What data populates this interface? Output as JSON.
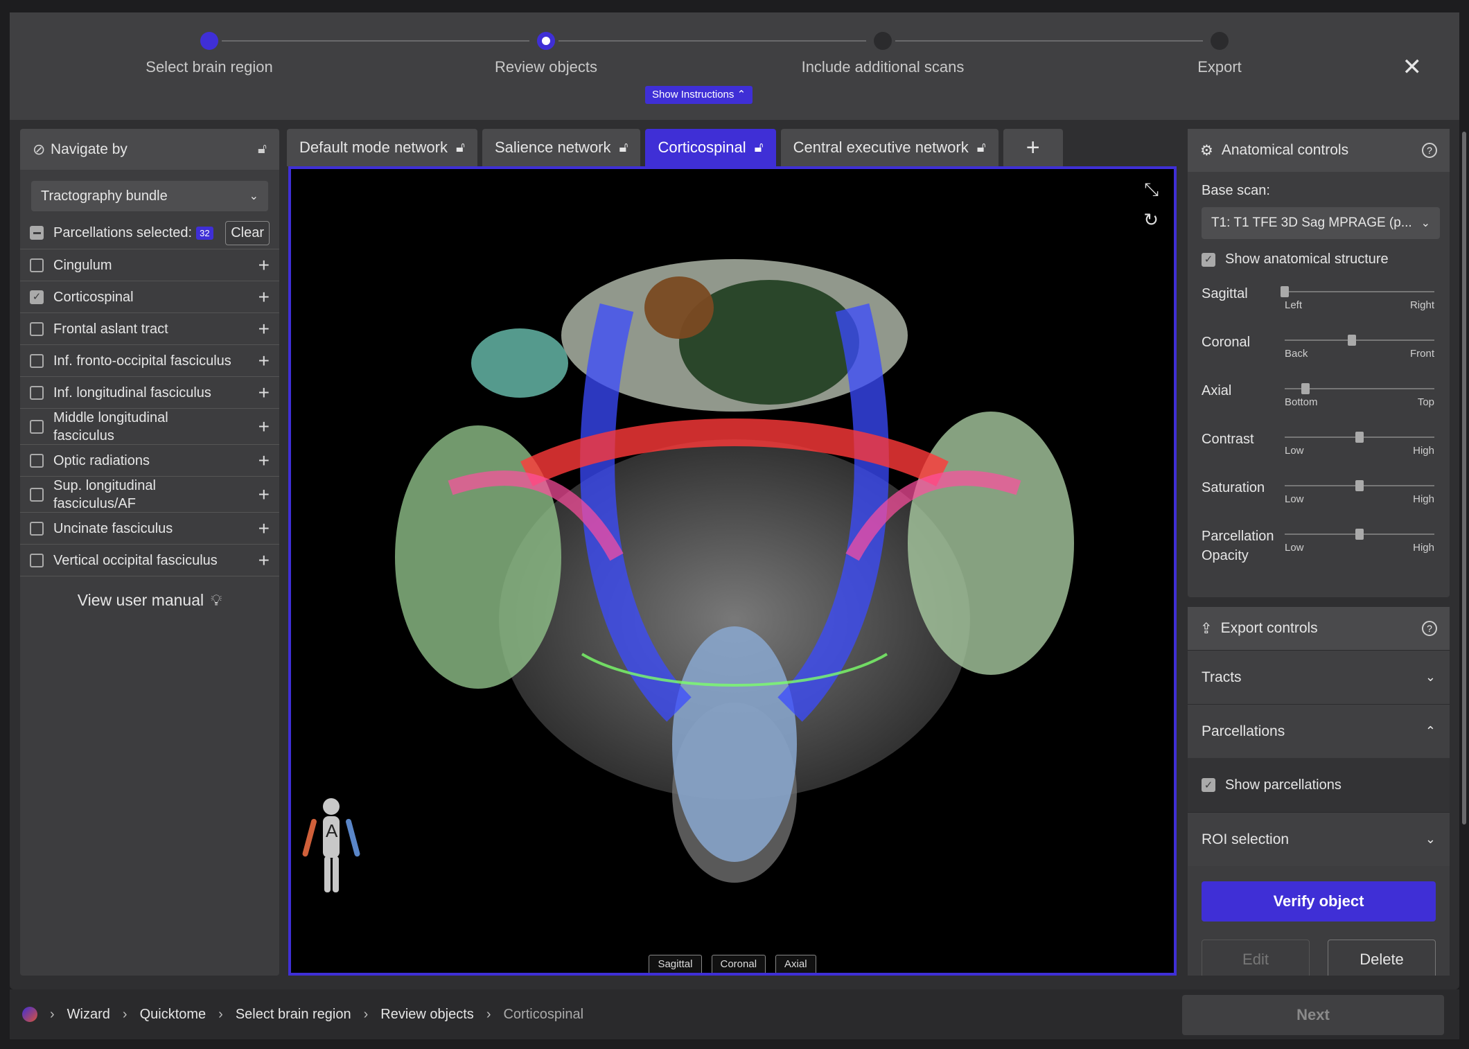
{
  "stepper": {
    "steps": [
      {
        "label": "Select brain region",
        "state": "done"
      },
      {
        "label": "Review objects",
        "state": "current"
      },
      {
        "label": "Include additional scans",
        "state": "todo"
      },
      {
        "label": "Export",
        "state": "todo"
      }
    ],
    "show_instructions": "Show Instructions",
    "close_icon": "close-icon"
  },
  "left": {
    "navigate_label": "Navigate by",
    "navigate_dropdown": "Tractography bundle",
    "parcellations_label": "Parcellations selected:",
    "parcellations_count": "32",
    "clear_label": "Clear",
    "items": [
      {
        "label": "Cingulum",
        "checked": false
      },
      {
        "label": "Corticospinal",
        "checked": true
      },
      {
        "label": "Frontal aslant tract",
        "checked": false
      },
      {
        "label": "Inf. fronto-occipital fasciculus",
        "checked": false
      },
      {
        "label": "Inf. longitudinal fasciculus",
        "checked": false
      },
      {
        "label": "Middle longitudinal fasciculus",
        "checked": false
      },
      {
        "label": "Optic radiations",
        "checked": false
      },
      {
        "label": "Sup. longitudinal fasciculus/AF",
        "checked": false
      },
      {
        "label": "Uncinate fasciculus",
        "checked": false
      },
      {
        "label": "Vertical occipital fasciculus",
        "checked": false
      }
    ],
    "manual_label": "View user manual"
  },
  "tabs": [
    {
      "label": "Default mode network",
      "active": false
    },
    {
      "label": "Salience network",
      "active": false
    },
    {
      "label": "Corticospinal",
      "active": true
    },
    {
      "label": "Central executive network",
      "active": false
    }
  ],
  "viewer": {
    "orientations": [
      "Sagittal",
      "Coronal",
      "Axial"
    ],
    "anterior_label": "A"
  },
  "anatomical": {
    "title": "Anatomical controls",
    "base_scan_label": "Base scan:",
    "base_scan_value": "T1: T1 TFE 3D Sag MPRAGE (p...",
    "show_structure": "Show anatomical structure",
    "sliders": [
      {
        "name": "Sagittal",
        "low": "Left",
        "high": "Right",
        "value": 0.0
      },
      {
        "name": "Coronal",
        "low": "Back",
        "high": "Front",
        "value": 0.45
      },
      {
        "name": "Axial",
        "low": "Bottom",
        "high": "Top",
        "value": 0.14
      },
      {
        "name": "Contrast",
        "low": "Low",
        "high": "High",
        "value": 0.5
      },
      {
        "name": "Saturation",
        "low": "Low",
        "high": "High",
        "value": 0.5
      },
      {
        "name": "Parcellation Opacity",
        "low": "Low",
        "high": "High",
        "value": 0.5
      }
    ]
  },
  "export": {
    "title": "Export controls",
    "tracts_label": "Tracts",
    "parcellations_label": "Parcellations",
    "show_parcellations": "Show parcellations",
    "roi_label": "ROI selection",
    "verify_label": "Verify object",
    "edit_label": "Edit",
    "delete_label": "Delete"
  },
  "footer": {
    "crumbs": [
      "Wizard",
      "Quicktome",
      "Select brain region",
      "Review objects",
      "Corticospinal"
    ],
    "next_label": "Next"
  },
  "colors": {
    "accent": "#3f2fd6",
    "panel": "#3d3d3f",
    "background": "#1d1d1f"
  }
}
